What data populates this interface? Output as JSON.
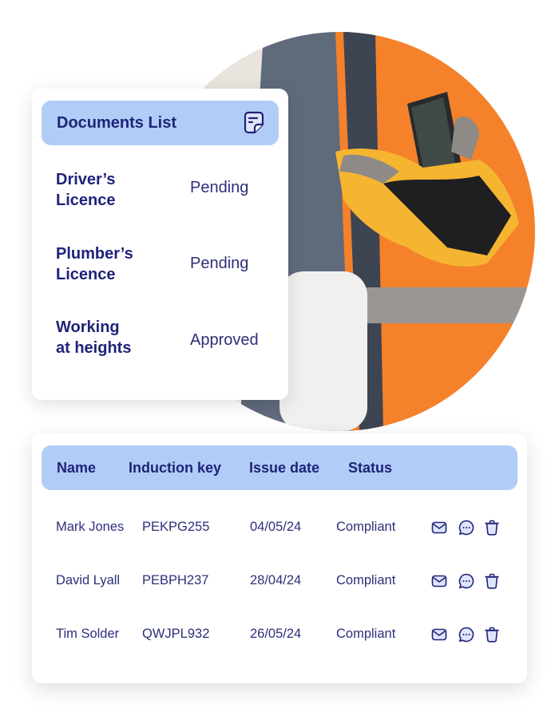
{
  "photo": {
    "description": "construction-worker-with-phone",
    "colors": {
      "vest": "#f5812a",
      "glove": "#f5b530",
      "shirt": "#5f6a7b",
      "helmet": "#eeeeee"
    }
  },
  "documents_card": {
    "title": "Documents List",
    "header_icon": "sticky-note-icon",
    "items": [
      {
        "name_line1": "Driver’s",
        "name_line2": "Licence",
        "status": "Pending"
      },
      {
        "name_line1": "Plumber’s",
        "name_line2": "Licence",
        "status": "Pending"
      },
      {
        "name_line1": "Working",
        "name_line2": "at heights",
        "status": "Approved"
      }
    ]
  },
  "table": {
    "columns": [
      "Name",
      "Induction key",
      "Issue date",
      "Status"
    ],
    "rows": [
      {
        "name": "Mark Jones",
        "key": "PEKPG255",
        "date": "04/05/24",
        "status": "Compliant"
      },
      {
        "name": "David Lyall",
        "key": "PEBPH237",
        "date": "28/04/24",
        "status": "Compliant"
      },
      {
        "name": "Tim Solder",
        "key": "QWJPL932",
        "date": "26/05/24",
        "status": "Compliant"
      }
    ],
    "actions": [
      "mail-icon",
      "chat-icon",
      "trash-icon"
    ]
  },
  "theme": {
    "accent": "#b1cdf7",
    "text": "#1f2378",
    "icon_fill": "#dfe5fb"
  }
}
